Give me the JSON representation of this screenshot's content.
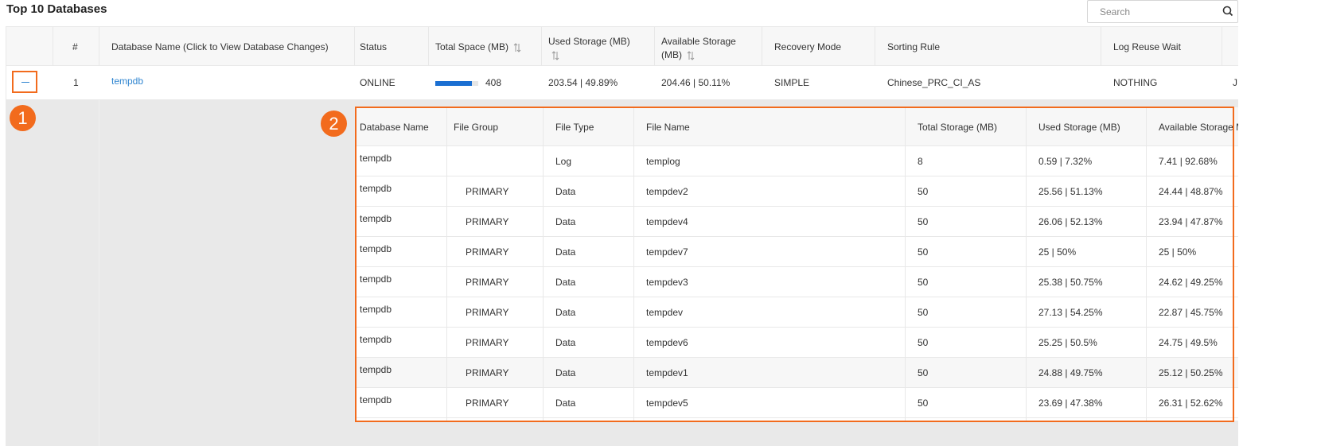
{
  "page": {
    "title": "Top 10 Databases"
  },
  "search": {
    "placeholder": "Search"
  },
  "table": {
    "columns": [
      {
        "label": "#"
      },
      {
        "label": "Database Name (Click to View Database Changes)"
      },
      {
        "label": "Status"
      },
      {
        "label": "Total Space (MB)"
      },
      {
        "label": "Used Storage (MB)"
      },
      {
        "label": "Available Storage (MB)"
      },
      {
        "label": "Recovery Mode"
      },
      {
        "label": "Sorting Rule"
      },
      {
        "label": "Log Reuse Wait"
      }
    ],
    "row": {
      "index": "1",
      "name": "tempdb",
      "status": "ONLINE",
      "total_space": "408",
      "total_space_bar_fraction": 0.85,
      "used": "203.54 | 49.89%",
      "available": "204.46 | 50.11%",
      "recovery": "SIMPLE",
      "sorting": "Chinese_PRC_CI_AS",
      "log_wait": "NOTHING",
      "next_col_fragment": "J"
    }
  },
  "files": {
    "columns": [
      {
        "label": "Database Name"
      },
      {
        "label": "File Group"
      },
      {
        "label": "File Type"
      },
      {
        "label": "File Name"
      },
      {
        "label": "Total Storage (MB)"
      },
      {
        "label": "Used Storage (MB)"
      },
      {
        "label": "Available Storage M"
      }
    ],
    "rows": [
      [
        "tempdb",
        "",
        "Log",
        "templog",
        "8",
        "0.59 | 7.32%",
        "7.41 | 92.68%"
      ],
      [
        "tempdb",
        "PRIMARY",
        "Data",
        "tempdev2",
        "50",
        "25.56 | 51.13%",
        "24.44 | 48.87%"
      ],
      [
        "tempdb",
        "PRIMARY",
        "Data",
        "tempdev4",
        "50",
        "26.06 | 52.13%",
        "23.94 | 47.87%"
      ],
      [
        "tempdb",
        "PRIMARY",
        "Data",
        "tempdev7",
        "50",
        "25 | 50%",
        "25 | 50%"
      ],
      [
        "tempdb",
        "PRIMARY",
        "Data",
        "tempdev3",
        "50",
        "25.38 | 50.75%",
        "24.62 | 49.25%"
      ],
      [
        "tempdb",
        "PRIMARY",
        "Data",
        "tempdev",
        "50",
        "27.13 | 54.25%",
        "22.87 | 45.75%"
      ],
      [
        "tempdb",
        "PRIMARY",
        "Data",
        "tempdev6",
        "50",
        "25.25 | 50.5%",
        "24.75 | 49.5%"
      ],
      [
        "tempdb",
        "PRIMARY",
        "Data",
        "tempdev1",
        "50",
        "24.88 | 49.75%",
        "25.12 | 50.25%"
      ],
      [
        "tempdb",
        "PRIMARY",
        "Data",
        "tempdev5",
        "50",
        "23.69 | 47.38%",
        "26.31 | 52.62%"
      ]
    ]
  },
  "callouts": {
    "first": "1",
    "second": "2"
  },
  "icons": {
    "search": "search-icon",
    "sort": "sort-icon",
    "collapse": "minus-icon"
  },
  "colors": {
    "accent": "#f26b1d",
    "link": "#2f85d0",
    "bar": "#1b6fd2"
  }
}
